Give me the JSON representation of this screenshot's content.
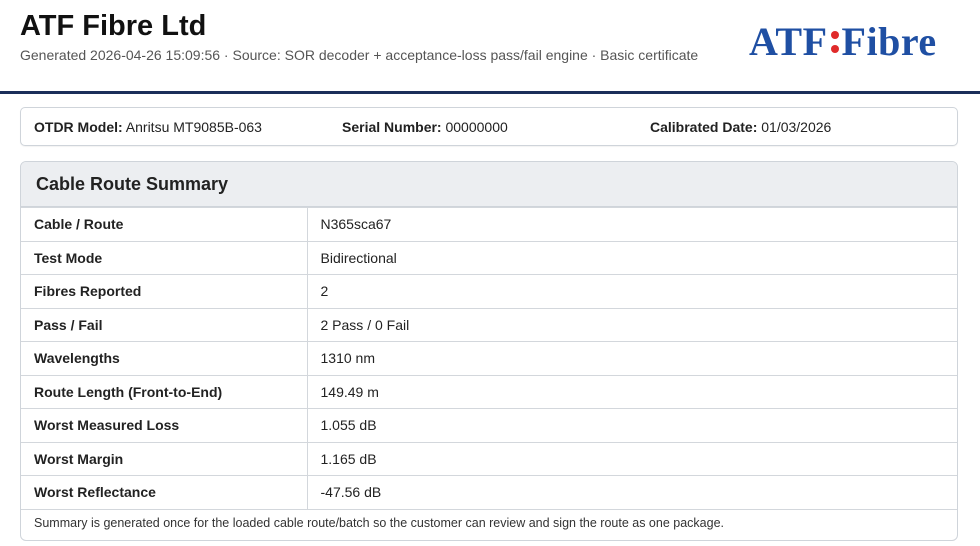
{
  "header": {
    "company": "ATF Fibre Ltd",
    "generated": "Generated 2026-04-26 15:09:56 · Source: SOR decoder + acceptance-loss pass/fail engine · Basic certificate",
    "logo_left": "ATF",
    "logo_right": "Fibre"
  },
  "device": {
    "model_label": "OTDR Model:",
    "model": "Anritsu MT9085B-063",
    "serial_label": "Serial Number:",
    "serial": "00000000",
    "calibrated_label": "Calibrated Date:",
    "calibrated": "01/03/2026"
  },
  "summary": {
    "title": "Cable Route Summary",
    "rows": [
      {
        "label": "Cable / Route",
        "value": "N365sca67"
      },
      {
        "label": "Test Mode",
        "value": "Bidirectional"
      },
      {
        "label": "Fibres Reported",
        "value": "2"
      },
      {
        "label": "Pass / Fail",
        "value": "2 Pass / 0 Fail"
      },
      {
        "label": "Wavelengths",
        "value": "1310 nm"
      },
      {
        "label": "Route Length (Front-to-End)",
        "value": "149.49 m"
      },
      {
        "label": "Worst Measured Loss",
        "value": "1.055 dB"
      },
      {
        "label": "Worst Margin",
        "value": "1.165 dB"
      },
      {
        "label": "Worst Reflectance",
        "value": "-47.56 dB"
      }
    ],
    "note": "Summary is generated once for the loaded cable route/batch so the customer can review and sign the route as one package."
  }
}
